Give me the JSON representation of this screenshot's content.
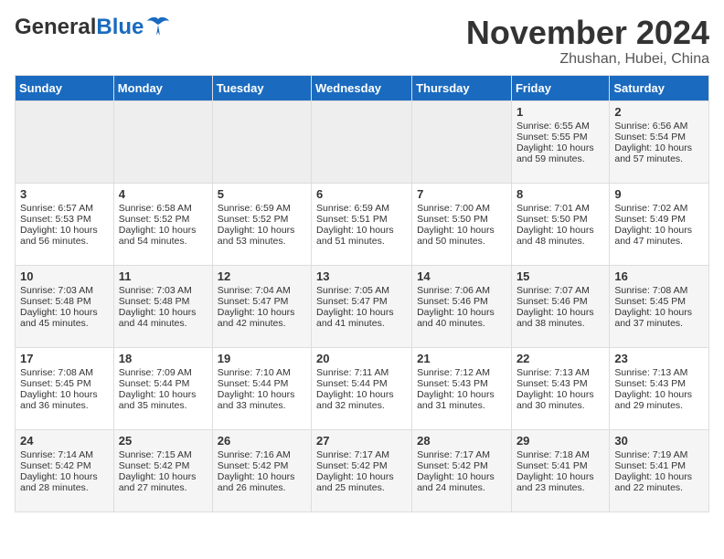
{
  "header": {
    "logo_general": "General",
    "logo_blue": "Blue",
    "month_title": "November 2024",
    "location": "Zhushan, Hubei, China"
  },
  "days_of_week": [
    "Sunday",
    "Monday",
    "Tuesday",
    "Wednesday",
    "Thursday",
    "Friday",
    "Saturday"
  ],
  "weeks": [
    [
      {
        "day": "",
        "sunrise": "",
        "sunset": "",
        "daylight": "",
        "empty": true
      },
      {
        "day": "",
        "sunrise": "",
        "sunset": "",
        "daylight": "",
        "empty": true
      },
      {
        "day": "",
        "sunrise": "",
        "sunset": "",
        "daylight": "",
        "empty": true
      },
      {
        "day": "",
        "sunrise": "",
        "sunset": "",
        "daylight": "",
        "empty": true
      },
      {
        "day": "",
        "sunrise": "",
        "sunset": "",
        "daylight": "",
        "empty": true
      },
      {
        "day": "1",
        "sunrise": "Sunrise: 6:55 AM",
        "sunset": "Sunset: 5:55 PM",
        "daylight": "Daylight: 10 hours and 59 minutes.",
        "empty": false
      },
      {
        "day": "2",
        "sunrise": "Sunrise: 6:56 AM",
        "sunset": "Sunset: 5:54 PM",
        "daylight": "Daylight: 10 hours and 57 minutes.",
        "empty": false
      }
    ],
    [
      {
        "day": "3",
        "sunrise": "Sunrise: 6:57 AM",
        "sunset": "Sunset: 5:53 PM",
        "daylight": "Daylight: 10 hours and 56 minutes.",
        "empty": false
      },
      {
        "day": "4",
        "sunrise": "Sunrise: 6:58 AM",
        "sunset": "Sunset: 5:52 PM",
        "daylight": "Daylight: 10 hours and 54 minutes.",
        "empty": false
      },
      {
        "day": "5",
        "sunrise": "Sunrise: 6:59 AM",
        "sunset": "Sunset: 5:52 PM",
        "daylight": "Daylight: 10 hours and 53 minutes.",
        "empty": false
      },
      {
        "day": "6",
        "sunrise": "Sunrise: 6:59 AM",
        "sunset": "Sunset: 5:51 PM",
        "daylight": "Daylight: 10 hours and 51 minutes.",
        "empty": false
      },
      {
        "day": "7",
        "sunrise": "Sunrise: 7:00 AM",
        "sunset": "Sunset: 5:50 PM",
        "daylight": "Daylight: 10 hours and 50 minutes.",
        "empty": false
      },
      {
        "day": "8",
        "sunrise": "Sunrise: 7:01 AM",
        "sunset": "Sunset: 5:50 PM",
        "daylight": "Daylight: 10 hours and 48 minutes.",
        "empty": false
      },
      {
        "day": "9",
        "sunrise": "Sunrise: 7:02 AM",
        "sunset": "Sunset: 5:49 PM",
        "daylight": "Daylight: 10 hours and 47 minutes.",
        "empty": false
      }
    ],
    [
      {
        "day": "10",
        "sunrise": "Sunrise: 7:03 AM",
        "sunset": "Sunset: 5:48 PM",
        "daylight": "Daylight: 10 hours and 45 minutes.",
        "empty": false
      },
      {
        "day": "11",
        "sunrise": "Sunrise: 7:03 AM",
        "sunset": "Sunset: 5:48 PM",
        "daylight": "Daylight: 10 hours and 44 minutes.",
        "empty": false
      },
      {
        "day": "12",
        "sunrise": "Sunrise: 7:04 AM",
        "sunset": "Sunset: 5:47 PM",
        "daylight": "Daylight: 10 hours and 42 minutes.",
        "empty": false
      },
      {
        "day": "13",
        "sunrise": "Sunrise: 7:05 AM",
        "sunset": "Sunset: 5:47 PM",
        "daylight": "Daylight: 10 hours and 41 minutes.",
        "empty": false
      },
      {
        "day": "14",
        "sunrise": "Sunrise: 7:06 AM",
        "sunset": "Sunset: 5:46 PM",
        "daylight": "Daylight: 10 hours and 40 minutes.",
        "empty": false
      },
      {
        "day": "15",
        "sunrise": "Sunrise: 7:07 AM",
        "sunset": "Sunset: 5:46 PM",
        "daylight": "Daylight: 10 hours and 38 minutes.",
        "empty": false
      },
      {
        "day": "16",
        "sunrise": "Sunrise: 7:08 AM",
        "sunset": "Sunset: 5:45 PM",
        "daylight": "Daylight: 10 hours and 37 minutes.",
        "empty": false
      }
    ],
    [
      {
        "day": "17",
        "sunrise": "Sunrise: 7:08 AM",
        "sunset": "Sunset: 5:45 PM",
        "daylight": "Daylight: 10 hours and 36 minutes.",
        "empty": false
      },
      {
        "day": "18",
        "sunrise": "Sunrise: 7:09 AM",
        "sunset": "Sunset: 5:44 PM",
        "daylight": "Daylight: 10 hours and 35 minutes.",
        "empty": false
      },
      {
        "day": "19",
        "sunrise": "Sunrise: 7:10 AM",
        "sunset": "Sunset: 5:44 PM",
        "daylight": "Daylight: 10 hours and 33 minutes.",
        "empty": false
      },
      {
        "day": "20",
        "sunrise": "Sunrise: 7:11 AM",
        "sunset": "Sunset: 5:44 PM",
        "daylight": "Daylight: 10 hours and 32 minutes.",
        "empty": false
      },
      {
        "day": "21",
        "sunrise": "Sunrise: 7:12 AM",
        "sunset": "Sunset: 5:43 PM",
        "daylight": "Daylight: 10 hours and 31 minutes.",
        "empty": false
      },
      {
        "day": "22",
        "sunrise": "Sunrise: 7:13 AM",
        "sunset": "Sunset: 5:43 PM",
        "daylight": "Daylight: 10 hours and 30 minutes.",
        "empty": false
      },
      {
        "day": "23",
        "sunrise": "Sunrise: 7:13 AM",
        "sunset": "Sunset: 5:43 PM",
        "daylight": "Daylight: 10 hours and 29 minutes.",
        "empty": false
      }
    ],
    [
      {
        "day": "24",
        "sunrise": "Sunrise: 7:14 AM",
        "sunset": "Sunset: 5:42 PM",
        "daylight": "Daylight: 10 hours and 28 minutes.",
        "empty": false
      },
      {
        "day": "25",
        "sunrise": "Sunrise: 7:15 AM",
        "sunset": "Sunset: 5:42 PM",
        "daylight": "Daylight: 10 hours and 27 minutes.",
        "empty": false
      },
      {
        "day": "26",
        "sunrise": "Sunrise: 7:16 AM",
        "sunset": "Sunset: 5:42 PM",
        "daylight": "Daylight: 10 hours and 26 minutes.",
        "empty": false
      },
      {
        "day": "27",
        "sunrise": "Sunrise: 7:17 AM",
        "sunset": "Sunset: 5:42 PM",
        "daylight": "Daylight: 10 hours and 25 minutes.",
        "empty": false
      },
      {
        "day": "28",
        "sunrise": "Sunrise: 7:17 AM",
        "sunset": "Sunset: 5:42 PM",
        "daylight": "Daylight: 10 hours and 24 minutes.",
        "empty": false
      },
      {
        "day": "29",
        "sunrise": "Sunrise: 7:18 AM",
        "sunset": "Sunset: 5:41 PM",
        "daylight": "Daylight: 10 hours and 23 minutes.",
        "empty": false
      },
      {
        "day": "30",
        "sunrise": "Sunrise: 7:19 AM",
        "sunset": "Sunset: 5:41 PM",
        "daylight": "Daylight: 10 hours and 22 minutes.",
        "empty": false
      }
    ]
  ]
}
